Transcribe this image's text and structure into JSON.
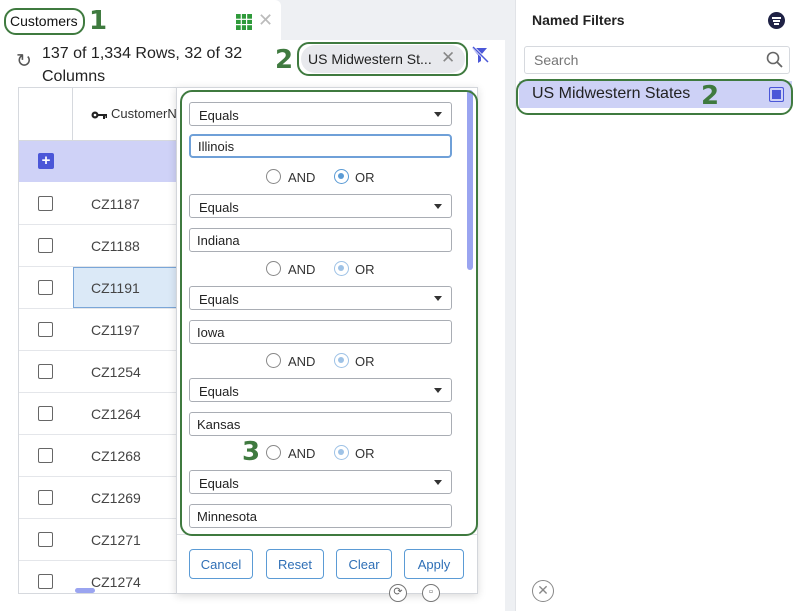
{
  "tab": {
    "title": "Customers"
  },
  "toolbar": {
    "row_info": "137 of 1,334 Rows, 32 of 32 Columns",
    "filter_chip": "US Midwestern St..."
  },
  "grid": {
    "column_header": "CustomerN",
    "rows": [
      "CZ1187",
      "CZ1188",
      "CZ1191",
      "CZ1197",
      "CZ1254",
      "CZ1264",
      "CZ1268",
      "CZ1269",
      "CZ1271",
      "CZ1274"
    ],
    "selected_row": "CZ1191"
  },
  "filter_popup": {
    "conditions": [
      {
        "operator": "Equals",
        "value": "Illinois"
      },
      {
        "operator": "Equals",
        "value": "Indiana"
      },
      {
        "operator": "Equals",
        "value": "Iowa"
      },
      {
        "operator": "Equals",
        "value": "Kansas"
      },
      {
        "operator": "Equals",
        "value": "Minnesota"
      }
    ],
    "join_and": "AND",
    "join_or": "OR",
    "buttons": {
      "cancel": "Cancel",
      "reset": "Reset",
      "clear": "Clear",
      "apply": "Apply"
    }
  },
  "named_filters": {
    "title": "Named Filters",
    "search_placeholder": "Search",
    "items": [
      {
        "label": "US Midwestern States"
      }
    ]
  },
  "annotations": {
    "n1": "1",
    "n2a": "2",
    "n2b": "2",
    "n3": "3"
  },
  "colors": {
    "accent": "#4b57d8",
    "annotation": "#3f7a3f",
    "selection": "#cdd1f6",
    "button": "#5b9bd5"
  }
}
